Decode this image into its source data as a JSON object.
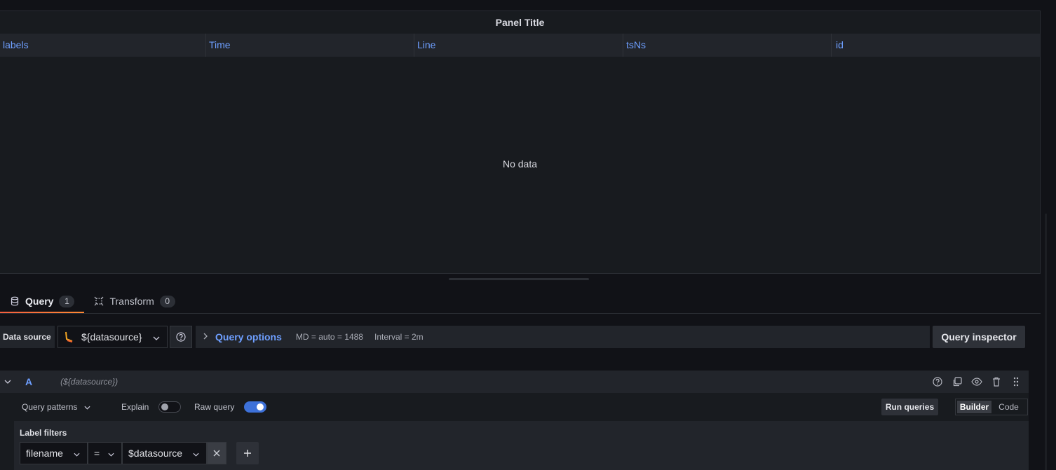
{
  "panel": {
    "title": "Panel Title",
    "columns": [
      "labels",
      "Time",
      "Line",
      "tsNs",
      "id"
    ],
    "empty_text": "No data"
  },
  "tabs": [
    {
      "label": "Query",
      "count": "1",
      "icon": "database-icon"
    },
    {
      "label": "Transform",
      "count": "0",
      "icon": "transform-icon"
    }
  ],
  "datasource_row": {
    "label": "Data source",
    "selected": "${datasource}",
    "query_options_label": "Query options",
    "md": "MD = auto = 1488",
    "interval": "Interval = 2m",
    "inspector_label": "Query inspector"
  },
  "query": {
    "ref_id": "A",
    "datasource_hint": "(${datasource})",
    "patterns_label": "Query patterns",
    "explain_label": "Explain",
    "explain_on": false,
    "raw_query_label": "Raw query",
    "raw_query_on": true,
    "run_label": "Run queries",
    "modes": [
      "Builder",
      "Code"
    ],
    "active_mode": "Builder",
    "label_filters_title": "Label filters",
    "filter": {
      "label": "filename",
      "op": "=",
      "value": "$datasource"
    }
  },
  "colors": {
    "accent": "#6e9fff",
    "tab_underline": "#f55f3e",
    "toggle_on": "#3d71d9"
  }
}
